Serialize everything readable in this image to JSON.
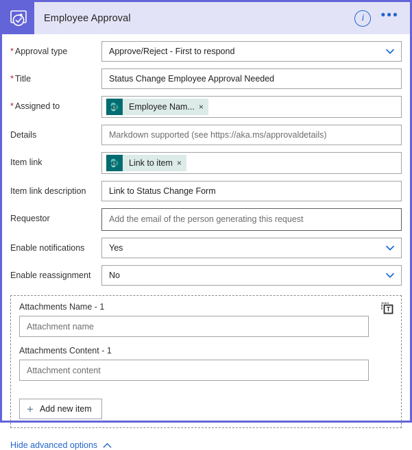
{
  "header": {
    "title": "Employee Approval",
    "app_icon": "approval-check-icon",
    "info_icon": "info-icon",
    "info_glyph": "i",
    "more_icon": "more-options-icon",
    "more_glyph": "•••",
    "accent_color": "#6264d8",
    "bar_color": "#e3e3f8"
  },
  "fields": {
    "approval_type": {
      "label": "Approval type",
      "required": true,
      "value": "Approve/Reject - First to respond",
      "control": "dropdown"
    },
    "title": {
      "label": "Title",
      "required": true,
      "value": "Status Change Employee Approval Needed",
      "control": "text"
    },
    "assigned_to": {
      "label": "Assigned to",
      "required": true,
      "control": "token",
      "token_label": "Employee Nam...",
      "token_icon": "sharepoint-icon",
      "token_remove": "×"
    },
    "details": {
      "label": "Details",
      "required": false,
      "placeholder": "Markdown supported (see https://aka.ms/approvaldetails)",
      "control": "text"
    },
    "item_link": {
      "label": "Item link",
      "required": false,
      "control": "token",
      "token_label": "Link to item",
      "token_icon": "sharepoint-icon",
      "token_remove": "×"
    },
    "item_link_description": {
      "label": "Item link description",
      "required": false,
      "value": "Link to Status Change Form",
      "control": "text"
    },
    "requestor": {
      "label": "Requestor",
      "required": false,
      "placeholder": "Add the email of the person generating this request",
      "control": "text",
      "focused": true
    },
    "enable_notifications": {
      "label": "Enable notifications",
      "required": false,
      "value": "Yes",
      "control": "dropdown"
    },
    "enable_reassignment": {
      "label": "Enable reassignment",
      "required": false,
      "value": "No",
      "control": "dropdown"
    }
  },
  "attachments": {
    "array_icon": "switch-to-text-mode-icon",
    "name": {
      "label": "Attachments Name - 1",
      "placeholder": "Attachment name"
    },
    "content": {
      "label": "Attachments Content - 1",
      "placeholder": "Attachment content"
    },
    "add_button": {
      "label": "Add new item",
      "plus_glyph": "+",
      "icon": "plus-icon"
    }
  },
  "footer": {
    "advanced_link": "Hide advanced options",
    "chevron_icon": "chevron-up-icon"
  }
}
